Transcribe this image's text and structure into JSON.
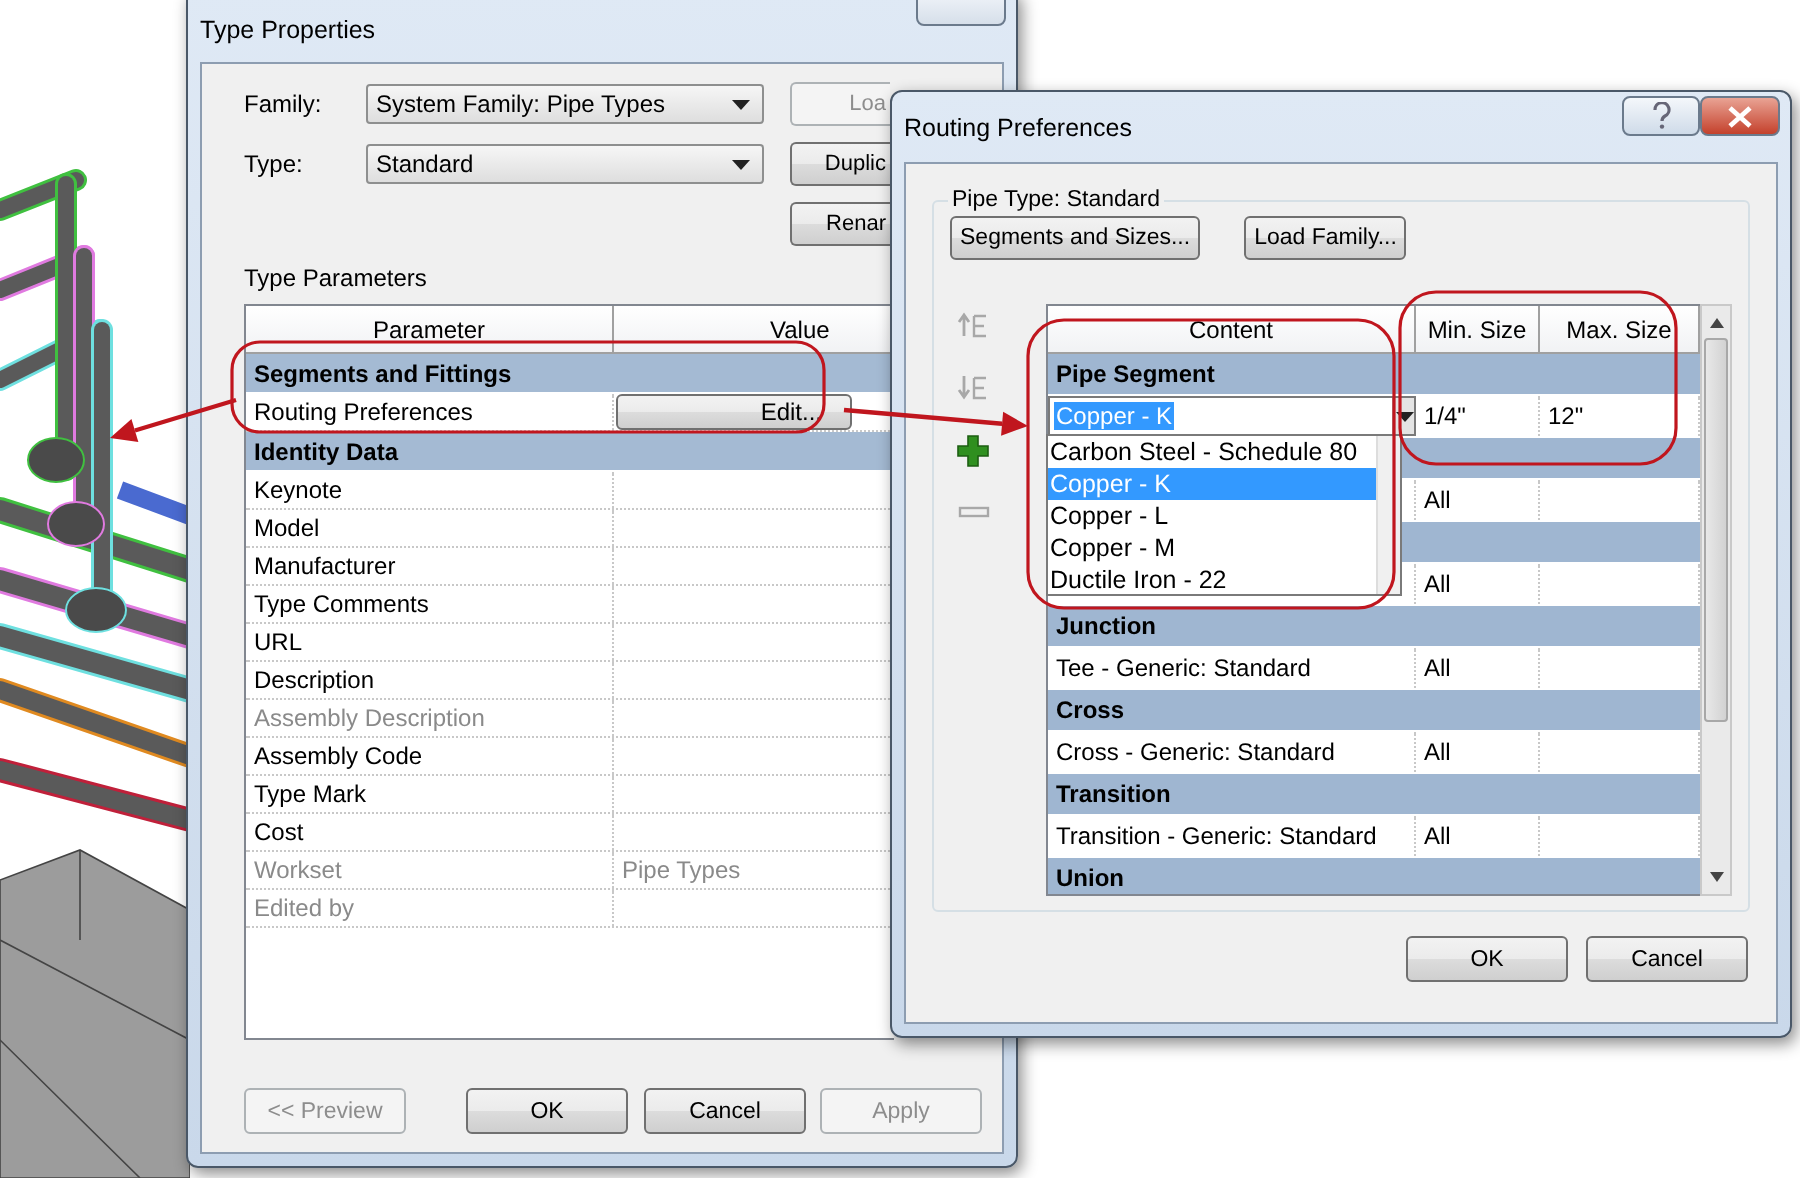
{
  "type_properties": {
    "title": "Type Properties",
    "fields": [
      {
        "label": "Family:",
        "value": "System Family: Pipe Types"
      },
      {
        "label": "Type:",
        "value": "Standard"
      }
    ],
    "side_buttons": [
      {
        "label": "Loa",
        "disabled": true
      },
      {
        "label": "Duplic",
        "disabled": false
      },
      {
        "label": "Renar",
        "disabled": false
      }
    ],
    "section_label": "Type Parameters",
    "columns": [
      "Parameter",
      "Value"
    ],
    "groups": [
      {
        "name": "Segments and Fittings",
        "rows": [
          {
            "parameter": "Routing Preferences",
            "kind": "button",
            "value": "Edit...",
            "disabled": false
          }
        ]
      },
      {
        "name": "Identity Data",
        "rows": [
          {
            "parameter": "Keynote",
            "kind": "text",
            "disabled": false
          },
          {
            "parameter": "Model",
            "kind": "text",
            "disabled": false
          },
          {
            "parameter": "Manufacturer",
            "kind": "text",
            "disabled": false
          },
          {
            "parameter": "Type Comments",
            "kind": "text",
            "disabled": false
          },
          {
            "parameter": "URL",
            "kind": "text",
            "disabled": false
          },
          {
            "parameter": "Description",
            "kind": "text",
            "disabled": false
          },
          {
            "parameter": "Assembly Description",
            "kind": "text",
            "disabled": true
          },
          {
            "parameter": "Assembly Code",
            "kind": "text",
            "disabled": false
          },
          {
            "parameter": "Type Mark",
            "kind": "text",
            "disabled": false
          },
          {
            "parameter": "Cost",
            "kind": "text",
            "disabled": false
          },
          {
            "parameter": "Workset",
            "kind": "text",
            "value": "Pipe Types",
            "disabled": true
          },
          {
            "parameter": "Edited by",
            "kind": "text",
            "disabled": true
          }
        ]
      }
    ],
    "buttons": [
      {
        "label": "<< Preview",
        "disabled": true
      },
      {
        "label": "OK",
        "disabled": false
      },
      {
        "label": "Cancel",
        "disabled": false
      },
      {
        "label": "Apply",
        "disabled": true
      }
    ]
  },
  "routing_preferences": {
    "title": "Routing Preferences",
    "group_label": "Pipe Type: Standard",
    "top_buttons": [
      "Segments and Sizes...",
      "Load Family..."
    ],
    "tools": [
      {
        "kind": "move_up",
        "disabled": true
      },
      {
        "kind": "move_down",
        "disabled": true
      },
      {
        "kind": "add",
        "disabled": false
      },
      {
        "kind": "remove",
        "disabled": true
      }
    ],
    "columns": [
      "Content",
      "Min. Size",
      "Max. Size"
    ],
    "groups": [
      {
        "name": "Pipe Segment",
        "rows": [
          {
            "kind": "combo",
            "content": "Copper - K",
            "min_size": "1/4\"",
            "max_size": "12\""
          }
        ]
      },
      {
        "rows": [
          {
            "kind": "text",
            "min_size": "All"
          }
        ]
      },
      {
        "rows": [
          {
            "kind": "text",
            "min_size": "All"
          }
        ]
      },
      {
        "name": "Junction",
        "rows": [
          {
            "kind": "text",
            "content": "Tee - Generic: Standard",
            "min_size": "All"
          }
        ]
      },
      {
        "name": "Cross",
        "rows": [
          {
            "kind": "text",
            "content": "Cross - Generic: Standard",
            "min_size": "All"
          }
        ]
      },
      {
        "name": "Transition",
        "rows": [
          {
            "kind": "text",
            "content": "Transition - Generic: Standard",
            "min_size": "All"
          }
        ]
      },
      {
        "name": "Union"
      }
    ],
    "dropdown": {
      "options": [
        {
          "label": "Carbon Steel - Schedule 80",
          "selected": false
        },
        {
          "label": "Copper - K",
          "selected": true
        },
        {
          "label": "Copper - L",
          "selected": false
        },
        {
          "label": "Copper - M",
          "selected": false
        },
        {
          "label": "Ductile Iron - 22",
          "selected": false
        }
      ]
    },
    "footer_buttons": [
      "OK",
      "Cancel"
    ]
  }
}
